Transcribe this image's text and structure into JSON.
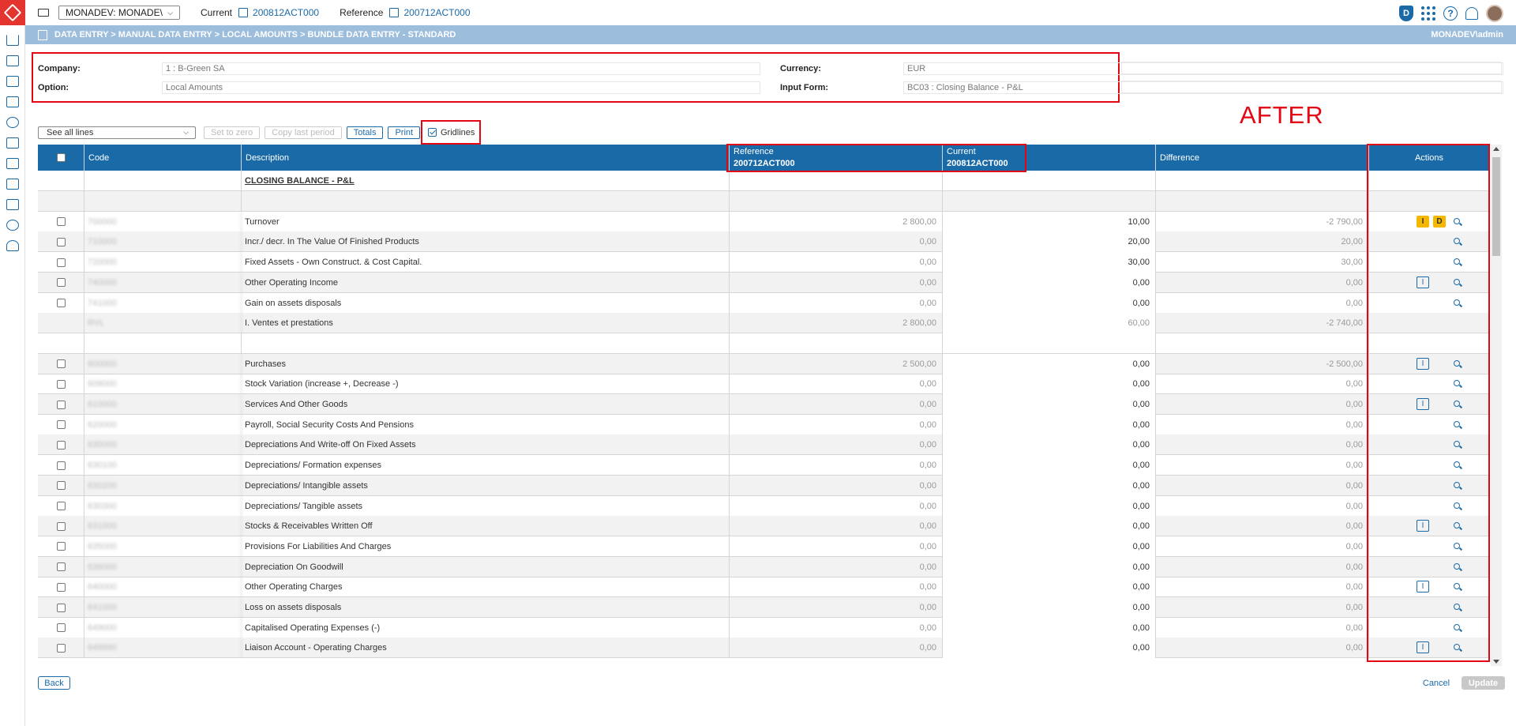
{
  "topbar": {
    "env_label": "MONADEV: MONADE\\",
    "current_label": "Current",
    "current_value": "200812ACT000",
    "reference_label": "Reference",
    "reference_value": "200712ACT000"
  },
  "breadcrumb": {
    "path": "DATA ENTRY > MANUAL DATA ENTRY > LOCAL AMOUNTS > BUNDLE DATA ENTRY - STANDARD",
    "user": "MONADEV\\admin"
  },
  "info": {
    "company_label": "Company:",
    "company_value": "1 : B-Green SA",
    "option_label": "Option:",
    "option_value": "Local Amounts",
    "currency_label": "Currency:",
    "currency_value": "EUR",
    "input_form_label": "Input Form:",
    "input_form_value": "BC03 : Closing Balance - P&L"
  },
  "annotation": "AFTER",
  "toolbar": {
    "lines_select": "See all lines",
    "set_to_zero": "Set to zero",
    "copy_last_period": "Copy last period",
    "totals": "Totals",
    "print": "Print",
    "gridlines": "Gridlines"
  },
  "table": {
    "headers": {
      "code": "Code",
      "description": "Description",
      "reference_title": "Reference",
      "reference_sub": "200712ACT000",
      "current_title": "Current",
      "current_sub": "200812ACT000",
      "difference": "Difference",
      "actions": "Actions"
    },
    "section_title": "CLOSING BALANCE - P&L",
    "rows": [
      {
        "type": "blank"
      },
      {
        "type": "data",
        "code": "700000",
        "desc": "Turnover",
        "ref": "2 800,00",
        "cur": "10,00",
        "diff": "-2 790,00",
        "actions": [
          "I_yellow",
          "D_yellow",
          "search"
        ]
      },
      {
        "type": "data",
        "code": "710000",
        "desc": "Incr./ decr. In The Value Of Finished Products",
        "ref": "0,00",
        "cur": "20,00",
        "diff": "20,00",
        "actions": [
          "search"
        ]
      },
      {
        "type": "data",
        "code": "720000",
        "desc": "Fixed Assets - Own Construct. & Cost Capital.",
        "ref": "0,00",
        "cur": "30,00",
        "diff": "30,00",
        "actions": [
          "search"
        ]
      },
      {
        "type": "data",
        "code": "740000",
        "desc": "Other Operating Income",
        "ref": "0,00",
        "cur": "0,00",
        "diff": "0,00",
        "actions": [
          "I",
          "search"
        ]
      },
      {
        "type": "data",
        "code": "741000",
        "desc": "Gain on assets disposals",
        "ref": "0,00",
        "cur": "0,00",
        "diff": "0,00",
        "actions": [
          "search"
        ]
      },
      {
        "type": "total",
        "code": "RVL",
        "desc": "I. Ventes et prestations",
        "ref": "2 800,00",
        "cur": "60,00",
        "diff": "-2 740,00",
        "actions": []
      },
      {
        "type": "blank"
      },
      {
        "type": "data",
        "code": "600000",
        "desc": "Purchases",
        "ref": "2 500,00",
        "cur": "0,00",
        "diff": "-2 500,00",
        "actions": [
          "I",
          "search"
        ]
      },
      {
        "type": "data",
        "code": "609000",
        "desc": "Stock Variation (increase +, Decrease -)",
        "ref": "0,00",
        "cur": "0,00",
        "diff": "0,00",
        "actions": [
          "search"
        ]
      },
      {
        "type": "data",
        "code": "610000",
        "desc": "Services And Other Goods",
        "ref": "0,00",
        "cur": "0,00",
        "diff": "0,00",
        "actions": [
          "I",
          "search"
        ]
      },
      {
        "type": "data",
        "code": "620000",
        "desc": "Payroll, Social Security Costs And Pensions",
        "ref": "0,00",
        "cur": "0,00",
        "diff": "0,00",
        "actions": [
          "search"
        ]
      },
      {
        "type": "data",
        "code": "630000",
        "desc": "Depreciations And Write-off On Fixed Assets",
        "ref": "0,00",
        "cur": "0,00",
        "diff": "0,00",
        "actions": [
          "search"
        ]
      },
      {
        "type": "data",
        "code": "630100",
        "desc": "Depreciations/ Formation expenses",
        "ref": "0,00",
        "cur": "0,00",
        "diff": "0,00",
        "actions": [
          "search"
        ]
      },
      {
        "type": "data",
        "code": "630200",
        "desc": "Depreciations/ Intangible assets",
        "ref": "0,00",
        "cur": "0,00",
        "diff": "0,00",
        "actions": [
          "search"
        ]
      },
      {
        "type": "data",
        "code": "630300",
        "desc": "Depreciations/ Tangible assets",
        "ref": "0,00",
        "cur": "0,00",
        "diff": "0,00",
        "actions": [
          "search"
        ]
      },
      {
        "type": "data",
        "code": "631000",
        "desc": "Stocks & Receivables Written Off",
        "ref": "0,00",
        "cur": "0,00",
        "diff": "0,00",
        "actions": [
          "I",
          "search"
        ]
      },
      {
        "type": "data",
        "code": "635000",
        "desc": "Provisions For Liabilities And Charges",
        "ref": "0,00",
        "cur": "0,00",
        "diff": "0,00",
        "actions": [
          "search"
        ]
      },
      {
        "type": "data",
        "code": "636000",
        "desc": "Depreciation On Goodwill",
        "ref": "0,00",
        "cur": "0,00",
        "diff": "0,00",
        "actions": [
          "search"
        ]
      },
      {
        "type": "data",
        "code": "640000",
        "desc": "Other Operating Charges",
        "ref": "0,00",
        "cur": "0,00",
        "diff": "0,00",
        "actions": [
          "I",
          "search"
        ]
      },
      {
        "type": "data",
        "code": "641000",
        "desc": "Loss on assets disposals",
        "ref": "0,00",
        "cur": "0,00",
        "diff": "0,00",
        "actions": [
          "search"
        ]
      },
      {
        "type": "data",
        "code": "649000",
        "desc": "Capitalised Operating Expenses (-)",
        "ref": "0,00",
        "cur": "0,00",
        "diff": "0,00",
        "actions": [
          "search"
        ]
      },
      {
        "type": "data",
        "code": "649990",
        "desc": "Liaison Account - Operating Charges",
        "ref": "0,00",
        "cur": "0,00",
        "diff": "0,00",
        "actions": [
          "I",
          "search"
        ]
      }
    ]
  },
  "footer": {
    "back": "Back",
    "cancel": "Cancel",
    "update": "Update"
  },
  "colors": {
    "primary": "#1a6aa8",
    "header_bar": "#9dbddc",
    "highlight": "#e30613",
    "badge_yellow": "#f5b800"
  }
}
